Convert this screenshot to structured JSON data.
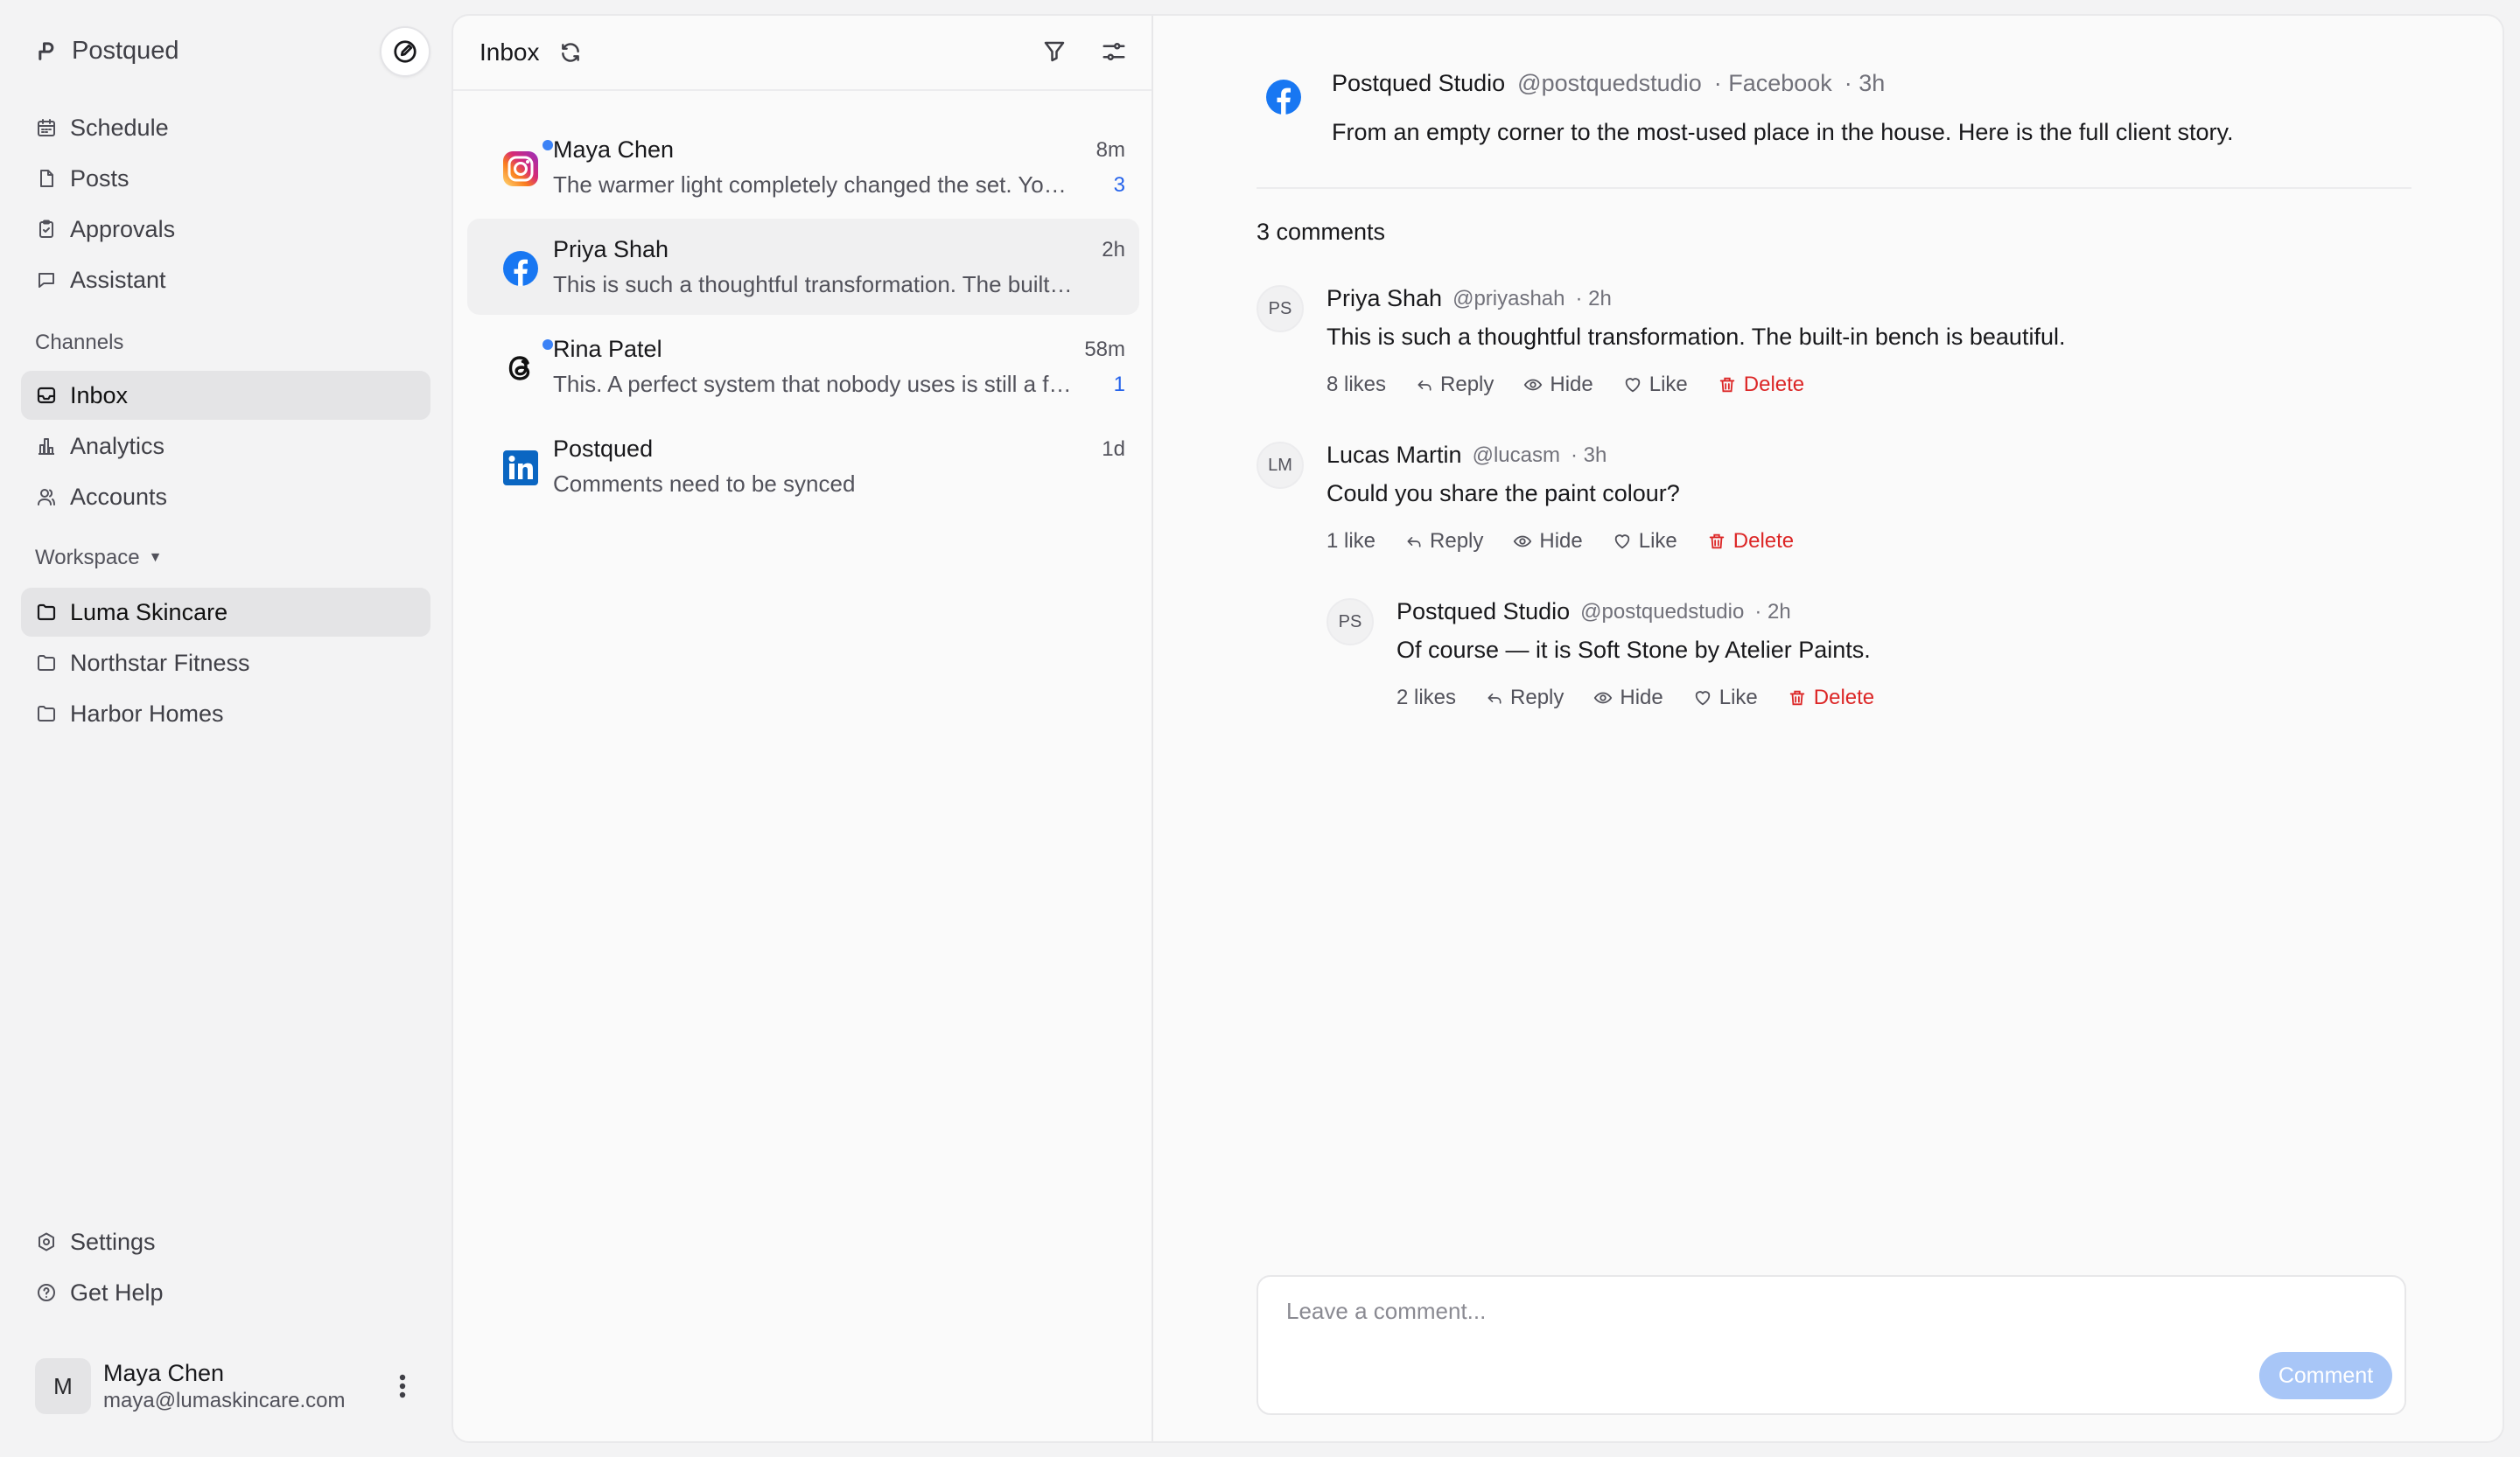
{
  "app": {
    "name": "Postqued"
  },
  "sidebar": {
    "nav": [
      {
        "label": "Schedule",
        "icon": "calendar-icon"
      },
      {
        "label": "Posts",
        "icon": "file-icon"
      },
      {
        "label": "Approvals",
        "icon": "clipboard-check-icon"
      },
      {
        "label": "Assistant",
        "icon": "chat-bubble-icon"
      }
    ],
    "channels_label": "Channels",
    "channels": [
      {
        "label": "Inbox",
        "icon": "inbox-icon",
        "active": true
      },
      {
        "label": "Analytics",
        "icon": "bar-chart-icon"
      },
      {
        "label": "Accounts",
        "icon": "users-icon"
      }
    ],
    "workspace_label": "Workspace",
    "workspaces": [
      {
        "label": "Luma Skincare",
        "active": true
      },
      {
        "label": "Northstar Fitness"
      },
      {
        "label": "Harbor Homes"
      }
    ],
    "footer": [
      {
        "label": "Settings",
        "icon": "gear-icon"
      },
      {
        "label": "Get Help",
        "icon": "help-circle-icon"
      }
    ],
    "user": {
      "initial": "M",
      "name": "Maya Chen",
      "email": "maya@lumaskincare.com"
    }
  },
  "inbox": {
    "title": "Inbox",
    "conversations": [
      {
        "platform": "instagram",
        "name": "Maya Chen",
        "time": "8m",
        "preview": "The warmer light completely changed the set. Your team really nailed it.",
        "count": "3",
        "unread": true
      },
      {
        "platform": "facebook",
        "name": "Priya Shah",
        "time": "2h",
        "preview": "This is such a thoughtful transformation. The built-in bench is beautiful.",
        "count": "",
        "unread": false,
        "selected": true
      },
      {
        "platform": "threads",
        "name": "Rina Patel",
        "time": "58m",
        "preview": "This. A perfect system that nobody uses is still a failed system.",
        "count": "1",
        "unread": true
      },
      {
        "platform": "linkedin",
        "name": "Postqued",
        "time": "1d",
        "preview": "Comments need to be synced",
        "count": "",
        "unread": false
      }
    ]
  },
  "post": {
    "author": "Postqued Studio",
    "handle": "@postquedstudio",
    "platform": "· Facebook",
    "time": "· 3h",
    "text": "From an empty corner to the most-used place in the house. Here is the full client story.",
    "comments_label": "3 comments",
    "comments": [
      {
        "initials": "PS",
        "name": "Priya Shah",
        "handle": "@priyashah",
        "time": "· 2h",
        "text": "This is such a thoughtful transformation. The built-in bench is beautiful.",
        "likes": "8 likes"
      },
      {
        "initials": "LM",
        "name": "Lucas Martin",
        "handle": "@lucasm",
        "time": "· 3h",
        "text": "Could you share the paint colour?",
        "likes": "1 like"
      },
      {
        "initials": "PS",
        "name": "Postqued Studio",
        "handle": "@postquedstudio",
        "time": "· 2h",
        "text": "Of course — it is Soft Stone by Atelier Paints.",
        "likes": "2 likes",
        "reply": true
      }
    ],
    "actions": {
      "reply": "Reply",
      "hide": "Hide",
      "like": "Like",
      "delete": "Delete"
    }
  },
  "composer": {
    "placeholder": "Leave a comment...",
    "button": "Comment"
  },
  "colors": {
    "accent": "#2563eb",
    "unread_dot": "#3b82f6",
    "danger": "#dc2626",
    "facebook": "#1877f2",
    "linkedin": "#0a66c2",
    "comment_button": "#a8c6f7"
  }
}
